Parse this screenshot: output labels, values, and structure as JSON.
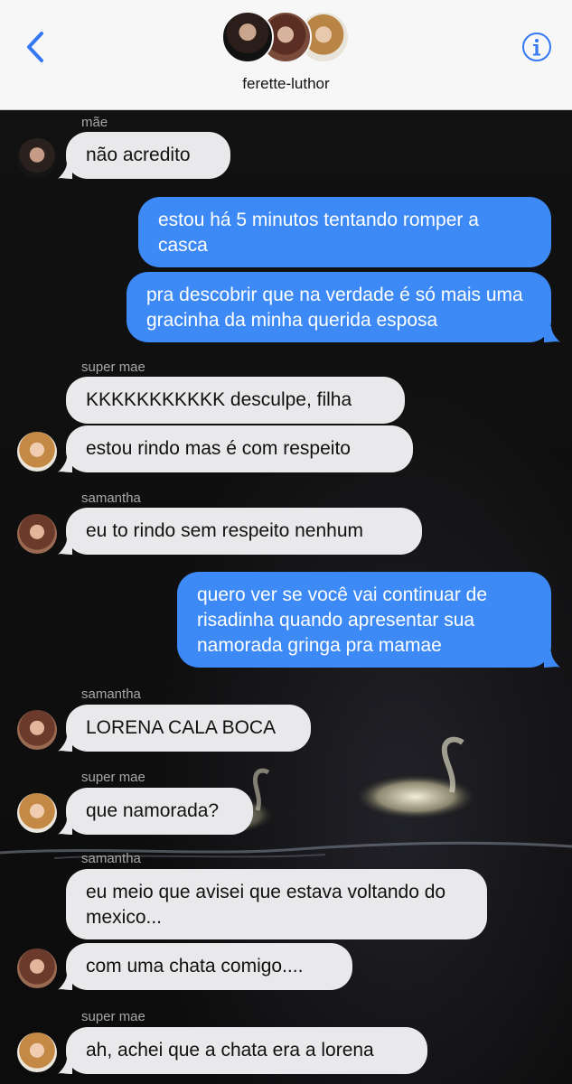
{
  "header": {
    "back_icon": "chevron-left-icon",
    "info_icon": "info-icon",
    "group_name": "ferette-luthor",
    "accent": "#3478f6"
  },
  "messages": [
    {
      "type": "sender",
      "text": "mãe"
    },
    {
      "type": "in",
      "text": "não acredito"
    },
    {
      "type": "out",
      "text": "estou há 5 minutos tentando romper a casca"
    },
    {
      "type": "out",
      "text": "pra descobrir que na verdade é só mais uma gracinha da minha querida esposa"
    },
    {
      "type": "sender",
      "text": "super mae"
    },
    {
      "type": "in",
      "text": "KKKKKKKKKKK desculpe, filha"
    },
    {
      "type": "in",
      "text": "estou rindo mas é com respeito"
    },
    {
      "type": "sender",
      "text": "samantha"
    },
    {
      "type": "in",
      "text": "eu to rindo sem respeito nenhum"
    },
    {
      "type": "out",
      "text": "quero ver se você vai continuar de risadinha quando apresentar sua namorada gringa pra mamae"
    },
    {
      "type": "sender",
      "text": "samantha"
    },
    {
      "type": "in",
      "text": "LORENA CALA BOCA"
    },
    {
      "type": "sender",
      "text": "super mae"
    },
    {
      "type": "in",
      "text": "que namorada?"
    },
    {
      "type": "sender",
      "text": "samantha"
    },
    {
      "type": "in",
      "text": "eu meio que avisei que estava voltando do mexico..."
    },
    {
      "type": "in",
      "text": "com uma chata comigo...."
    },
    {
      "type": "sender",
      "text": "super mae"
    },
    {
      "type": "in",
      "text": "ah, achei que a chata era a lorena"
    }
  ],
  "colors": {
    "incoming_bubble": "#e9e9eb",
    "outgoing_bubble": "#3d8af7",
    "chat_background": "#0b0b0b"
  }
}
